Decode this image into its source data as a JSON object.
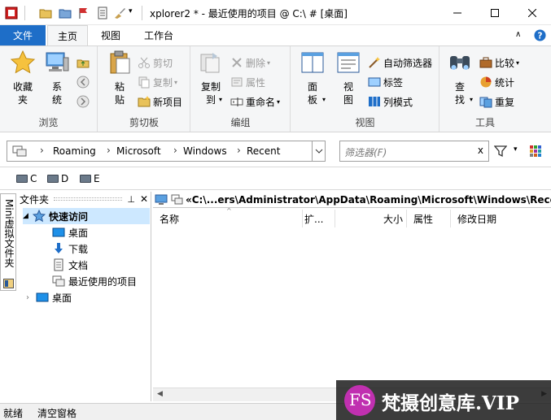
{
  "window": {
    "title": "xplorer2 * - 最近使用的项目 @ C:\\ # [桌面]"
  },
  "ribbon_tabs": {
    "file": "文件",
    "home": "主页",
    "view": "视图",
    "desktop": "工作台"
  },
  "groups": {
    "browse": {
      "label": "浏览",
      "favorites": "收藏\n夹",
      "system": "系\n统"
    },
    "clipboard": {
      "label": "剪切板",
      "paste": "粘\n贴",
      "cut": "剪切",
      "copy": "复制",
      "new_item": "新项目"
    },
    "edit": {
      "label": "编组",
      "copy_to": "复制\n到",
      "delete": "删除",
      "properties": "属性",
      "rename": "重命名"
    },
    "view": {
      "label": "视图",
      "panel": "面\n板",
      "view": "视\n图",
      "auto_filter": "自动筛选器",
      "tags": "标签",
      "column_mode": "列模式"
    },
    "tools": {
      "label": "工具",
      "find": "查\n找",
      "compare": "比较",
      "stats": "统计",
      "duplicates": "重复"
    }
  },
  "address": {
    "crumbs": [
      "Roaming",
      "Microsoft",
      "Windows",
      "Recent"
    ],
    "filter_placeholder": "筛选器(F)",
    "filter_clear": "x"
  },
  "drives": [
    "C",
    "D",
    "E"
  ],
  "side_tab": "Mini虚拟文件夹",
  "tree": {
    "header": "文件夹",
    "nodes": {
      "quick_access": "快速访问",
      "desktop": "桌面",
      "downloads": "下载",
      "documents": "文档",
      "recent": "最近使用的项目",
      "desktop_root": "桌面"
    }
  },
  "list": {
    "path": "«C:\\...ers\\Administrator\\AppData\\Roaming\\Microsoft\\Windows\\Recent",
    "columns": {
      "name": "名称",
      "ext": "扩...",
      "size": "大小",
      "attr": "属性",
      "modified": "修改日期"
    }
  },
  "status": {
    "ready": "就绪",
    "clear_pane": "清空窗格"
  },
  "watermark": {
    "logo": "FS",
    "text": "梵摄创意库.VIP"
  },
  "colors": {
    "accent": "#1e6ec8",
    "ribbon_bg": "#f5f6f7",
    "selection": "#cde8ff"
  }
}
